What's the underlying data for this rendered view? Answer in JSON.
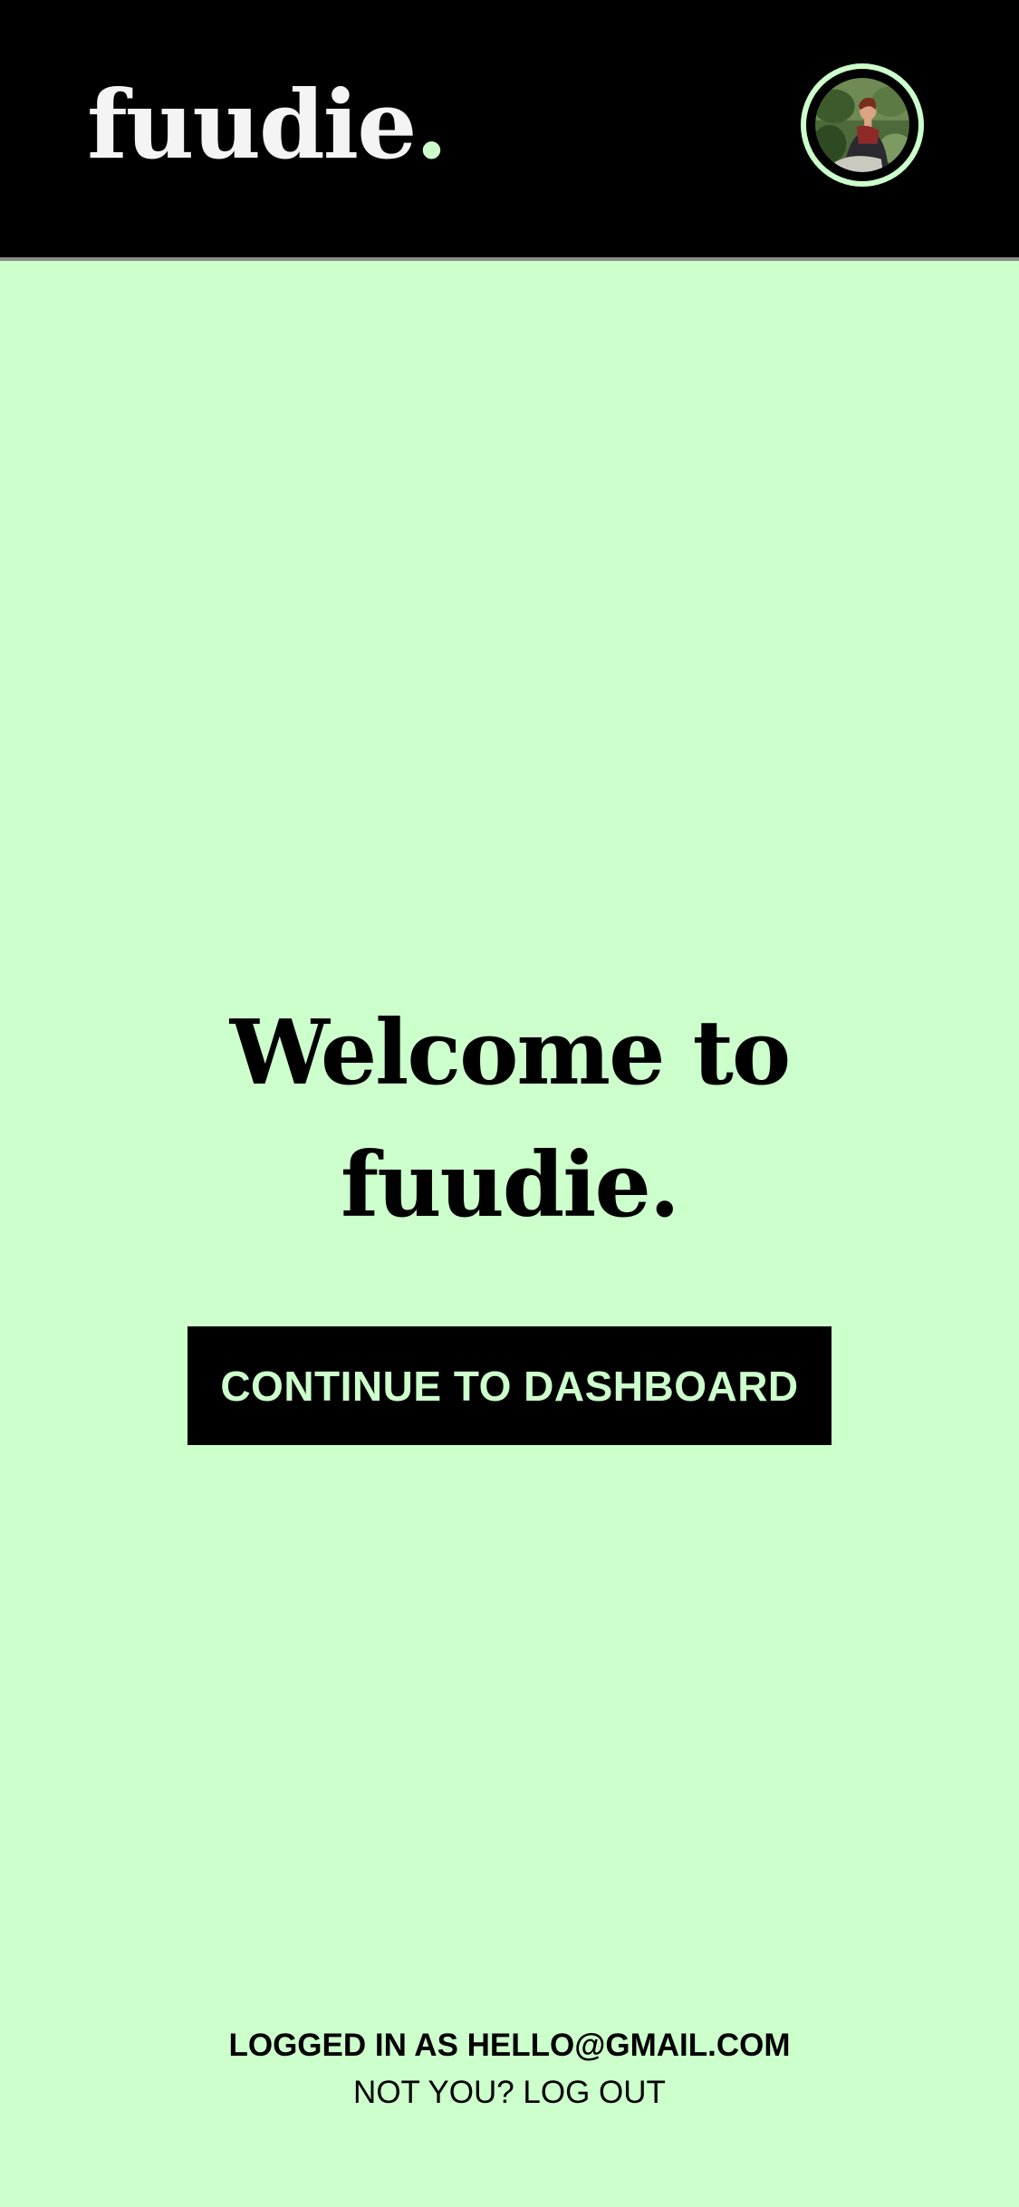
{
  "header": {
    "logo_text": "fuudie",
    "logo_dot": ".",
    "accent_color": "#ccffcc",
    "background_color": "#000000"
  },
  "main": {
    "welcome_line1": "Welcome to",
    "welcome_line2": "fuudie.",
    "cta_label": "CONTINUE TO DASHBOARD"
  },
  "footer": {
    "logged_in_text": "LOGGED IN AS HELLO@GMAIL.COM",
    "logout_text": "NOT YOU? LOG OUT"
  },
  "theme": {
    "page_background": "#ccffcc",
    "text_color": "#000000"
  }
}
